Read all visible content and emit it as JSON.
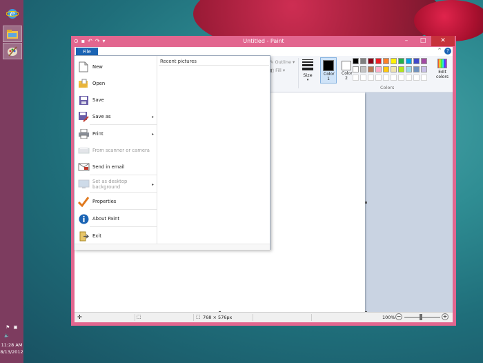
{
  "window": {
    "title": "Untitled - Paint",
    "file_tab": "File"
  },
  "ribbon": {
    "outline_label": "Outline",
    "fill_label": "Fill",
    "size_label": "Size",
    "color1_label": "Color 1",
    "color2_label": "Color 2",
    "edit_colors_label": "Edit colors",
    "colors_group_label": "Colors",
    "color1_value": "#000000",
    "color2_value": "#ffffff",
    "palette_row1": [
      "#000000",
      "#7f7f7f",
      "#880015",
      "#ed1c24",
      "#ff7f27",
      "#fff200",
      "#22b14c",
      "#00a2e8",
      "#3f48cc",
      "#a349a4"
    ],
    "palette_row2": [
      "#ffffff",
      "#c3c3c3",
      "#b97a57",
      "#ffaec9",
      "#ffc90e",
      "#efe4b0",
      "#b5e61d",
      "#99d9ea",
      "#7092be",
      "#c8bfe7"
    ]
  },
  "file_menu": {
    "items": [
      {
        "label": "New",
        "icon": "new-icon",
        "submenu": false,
        "disabled": false
      },
      {
        "label": "Open",
        "icon": "open-icon",
        "submenu": false,
        "disabled": false
      },
      {
        "label": "Save",
        "icon": "save-icon",
        "submenu": false,
        "disabled": false
      },
      {
        "label": "Save as",
        "icon": "save-as-icon",
        "submenu": true,
        "disabled": false
      },
      {
        "label": "Print",
        "icon": "print-icon",
        "submenu": true,
        "disabled": false
      },
      {
        "label": "From scanner or camera",
        "icon": "scanner-icon",
        "submenu": false,
        "disabled": true
      },
      {
        "label": "Send in email",
        "icon": "email-icon",
        "submenu": false,
        "disabled": false
      },
      {
        "label": "Set as desktop background",
        "icon": "desktop-background-icon",
        "submenu": true,
        "disabled": true
      },
      {
        "label": "Properties",
        "icon": "properties-checkmark-icon",
        "submenu": false,
        "disabled": false
      },
      {
        "label": "About Paint",
        "icon": "info-icon",
        "submenu": false,
        "disabled": false
      },
      {
        "label": "Exit",
        "icon": "exit-icon",
        "submenu": false,
        "disabled": false
      }
    ],
    "recent_title": "Recent pictures"
  },
  "statusbar": {
    "dimensions": "768 × 576px",
    "zoom": "100%"
  },
  "tray": {
    "time": "11:28 AM",
    "date": "8/13/2012"
  }
}
